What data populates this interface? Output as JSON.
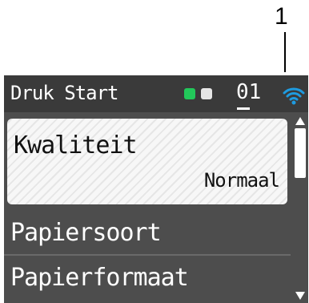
{
  "callout": {
    "number": "1"
  },
  "status_bar": {
    "title": "Druk Start",
    "counter": "01",
    "led_colors": [
      "#22c85a",
      "#e6e6e6"
    ],
    "wifi_icon": "wifi-icon",
    "wifi_color": "#1e9be0"
  },
  "menu": {
    "selected": {
      "label": "Kwaliteit",
      "value": "Normaal"
    },
    "items": [
      {
        "label": "Papiersoort"
      },
      {
        "label": "Papierformaat"
      }
    ]
  },
  "colors": {
    "screen_background": "#4d4d4d",
    "status_background": "#3a3a3a",
    "text_light": "#ffffff"
  }
}
